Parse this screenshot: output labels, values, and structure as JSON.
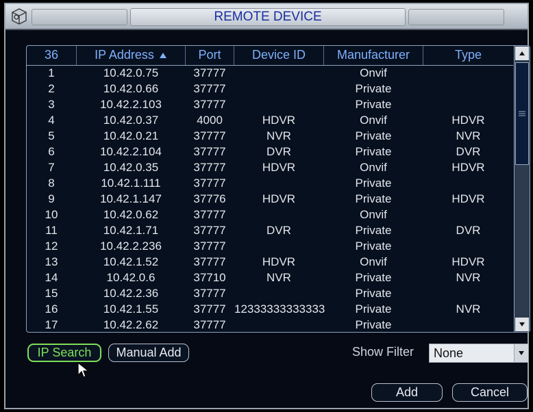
{
  "window": {
    "title": "REMOTE DEVICE"
  },
  "table": {
    "headers": {
      "index": "36",
      "ip": "IP Address",
      "ip_sort_icon": "triangle-up",
      "port": "Port",
      "device_id": "Device ID",
      "manufacturer": "Manufacturer",
      "type": "Type"
    },
    "rows": [
      {
        "idx": "1",
        "ip": "10.42.0.75",
        "port": "37777",
        "device_id": "",
        "mfr": "Onvif",
        "type": ""
      },
      {
        "idx": "2",
        "ip": "10.42.0.66",
        "port": "37777",
        "device_id": "",
        "mfr": "Private",
        "type": ""
      },
      {
        "idx": "3",
        "ip": "10.42.2.103",
        "port": "37777",
        "device_id": "",
        "mfr": "Private",
        "type": ""
      },
      {
        "idx": "4",
        "ip": "10.42.0.37",
        "port": "4000",
        "device_id": "HDVR",
        "mfr": "Onvif",
        "type": "HDVR"
      },
      {
        "idx": "5",
        "ip": "10.42.0.21",
        "port": "37777",
        "device_id": "NVR",
        "mfr": "Private",
        "type": "NVR"
      },
      {
        "idx": "6",
        "ip": "10.42.2.104",
        "port": "37777",
        "device_id": "DVR",
        "mfr": "Private",
        "type": "DVR"
      },
      {
        "idx": "7",
        "ip": "10.42.0.35",
        "port": "37777",
        "device_id": "HDVR",
        "mfr": "Onvif",
        "type": "HDVR"
      },
      {
        "idx": "8",
        "ip": "10.42.1.111",
        "port": "37777",
        "device_id": "",
        "mfr": "Private",
        "type": ""
      },
      {
        "idx": "9",
        "ip": "10.42.1.147",
        "port": "37776",
        "device_id": "HDVR",
        "mfr": "Private",
        "type": "HDVR"
      },
      {
        "idx": "10",
        "ip": "10.42.0.62",
        "port": "37777",
        "device_id": "",
        "mfr": "Onvif",
        "type": ""
      },
      {
        "idx": "11",
        "ip": "10.42.1.71",
        "port": "37777",
        "device_id": "DVR",
        "mfr": "Private",
        "type": "DVR"
      },
      {
        "idx": "12",
        "ip": "10.42.2.236",
        "port": "37777",
        "device_id": "",
        "mfr": "Private",
        "type": ""
      },
      {
        "idx": "13",
        "ip": "10.42.1.52",
        "port": "37777",
        "device_id": "HDVR",
        "mfr": "Onvif",
        "type": "HDVR"
      },
      {
        "idx": "14",
        "ip": "10.42.0.6",
        "port": "37710",
        "device_id": "NVR",
        "mfr": "Private",
        "type": "NVR"
      },
      {
        "idx": "15",
        "ip": "10.42.2.36",
        "port": "37777",
        "device_id": "",
        "mfr": "Private",
        "type": ""
      },
      {
        "idx": "16",
        "ip": "10.42.1.55",
        "port": "37777",
        "device_id": "12333333333333",
        "mfr": "Private",
        "type": "NVR"
      },
      {
        "idx": "17",
        "ip": "10.42.2.62",
        "port": "37777",
        "device_id": "",
        "mfr": "Private",
        "type": ""
      }
    ]
  },
  "buttons": {
    "ip_search": "IP Search",
    "manual_add": "Manual Add",
    "add": "Add",
    "cancel": "Cancel"
  },
  "filter": {
    "label": "Show Filter",
    "value": "None"
  },
  "colors": {
    "title": "#1a2f9e",
    "header_text": "#7fb0ff",
    "active_button": "#7ee05a",
    "background": "#060a14"
  }
}
